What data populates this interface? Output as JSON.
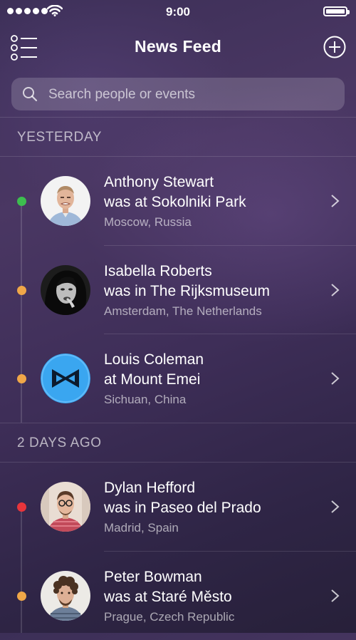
{
  "status_bar": {
    "time": "9:00"
  },
  "nav": {
    "title": "News Feed"
  },
  "search": {
    "placeholder": "Search people or events"
  },
  "sections": [
    {
      "header": "YESTERDAY"
    },
    {
      "header": "2 DAYS AGO"
    }
  ],
  "entries": [
    {
      "name": "Anthony Stewart",
      "event": "was at Sokolniki Park",
      "location": "Moscow, Russia",
      "dot_color": "#3dbe4f"
    },
    {
      "name": "Isabella Roberts",
      "event": "was in The Rijksmuseum",
      "location": "Amsterdam, The Netherlands",
      "dot_color": "#f0a748"
    },
    {
      "name": "Louis Coleman",
      "event": "at Mount Emei",
      "location": "Sichuan, China",
      "dot_color": "#f0a748"
    },
    {
      "name": "Dylan Hefford",
      "event": "was in Paseo del Prado",
      "location": "Madrid, Spain",
      "dot_color": "#e8353b"
    },
    {
      "name": "Peter Bowman",
      "event": "was at Staré Město",
      "location": "Prague, Czech Republic",
      "dot_color": "#f0a748"
    }
  ],
  "colors": {
    "background": "#3e2e58",
    "online": "#3dbe4f",
    "away": "#f0a748",
    "busy": "#e8353b",
    "logo_blue": "#3aa6f0"
  }
}
